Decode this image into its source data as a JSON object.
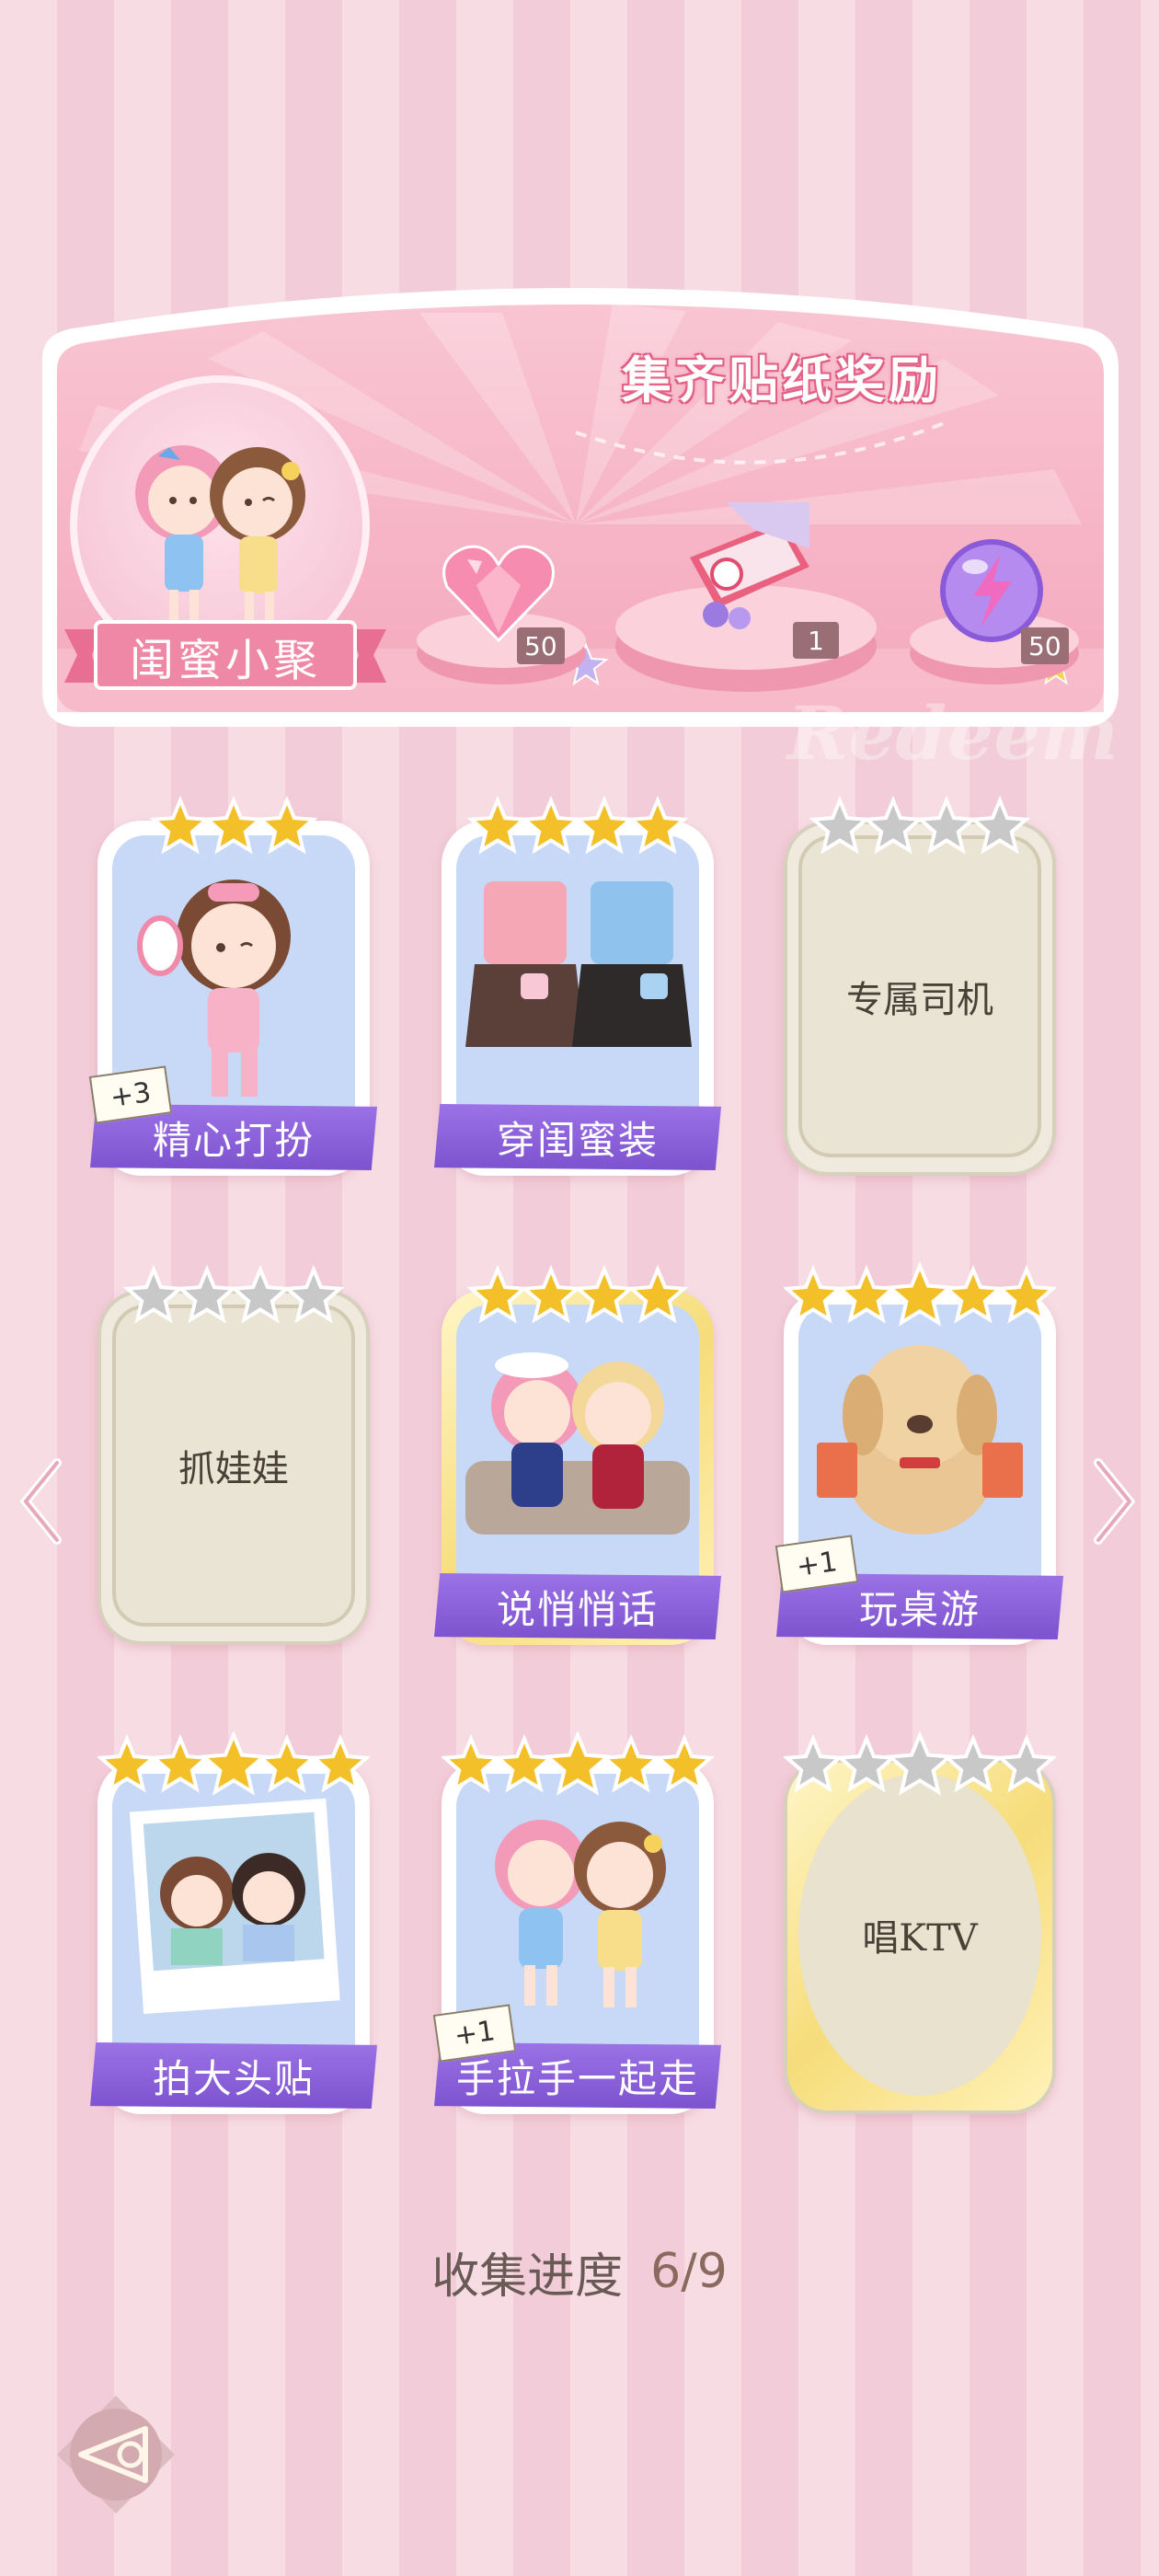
{
  "banner": {
    "title": "集齐贴纸奖励",
    "watermark": "Redeem",
    "party_label": "闺蜜小聚",
    "rewards": [
      {
        "icon": "pink-heart-gem-icon",
        "count": "50"
      },
      {
        "icon": "gift-box-icon",
        "count": "1"
      },
      {
        "icon": "purple-energy-orb-icon",
        "count": "50"
      }
    ]
  },
  "cards": [
    {
      "name": "精心打扮",
      "stars": 3,
      "unlocked": true,
      "plus": "+3"
    },
    {
      "name": "穿闺蜜装",
      "stars": 4,
      "unlocked": true,
      "plus": ""
    },
    {
      "name": "专属司机",
      "stars": 4,
      "unlocked": false,
      "plus": ""
    },
    {
      "name": "抓娃娃",
      "stars": 4,
      "unlocked": false,
      "plus": ""
    },
    {
      "name": "说悄悄话",
      "stars": 4,
      "unlocked": true,
      "plus": ""
    },
    {
      "name": "玩桌游",
      "stars": 5,
      "unlocked": true,
      "plus": "+1"
    },
    {
      "name": "拍大头贴",
      "stars": 5,
      "unlocked": true,
      "plus": ""
    },
    {
      "name": "手拉手一起走",
      "stars": 5,
      "unlocked": true,
      "plus": "+1"
    },
    {
      "name": "唱KTV",
      "stars": 5,
      "unlocked": false,
      "plus": ""
    }
  ],
  "progress": {
    "label": "收集进度",
    "value": "6/9",
    "collected": 6,
    "total": 9
  },
  "colors": {
    "accent_purple": "#8a5ad8",
    "banner_pink": "#f2a2b8",
    "star_gold": "#f4c02a",
    "star_gray": "#c8c8c8"
  },
  "icons": {
    "back": "back-triangle-icon",
    "prev": "chevron-left-icon",
    "next": "chevron-right-icon"
  }
}
